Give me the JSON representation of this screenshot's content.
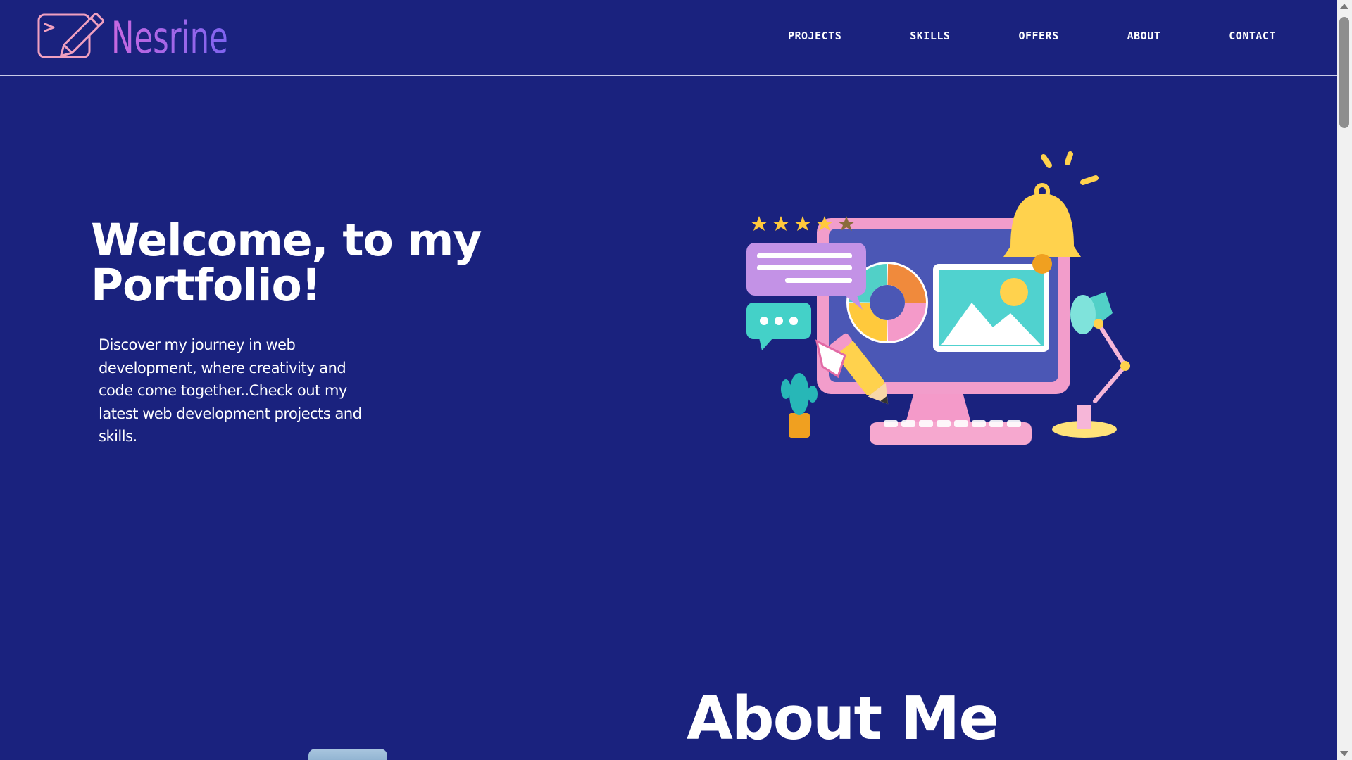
{
  "brand": {
    "name": "Nesrine",
    "gradient": [
      "#c868e0",
      "#7e64f0"
    ],
    "icon_color": "#f0a0c0"
  },
  "nav": {
    "items": [
      {
        "label": "PROJECTS"
      },
      {
        "label": "SKILLS"
      },
      {
        "label": "OFFERS"
      },
      {
        "label": "ABOUT"
      },
      {
        "label": "CONTACT"
      }
    ]
  },
  "hero": {
    "title": "Welcome, to my Portfolio!",
    "text": "Discover my journey in web development, where creativity and code come together..Check out my latest web development projects and skills.",
    "illustration_icon": "computer-workspace-illustration",
    "rating_stars": 4,
    "rating_max": 5
  },
  "about": {
    "title": "About Me"
  },
  "colors": {
    "background": "#1a227e",
    "text": "#ffffff"
  }
}
